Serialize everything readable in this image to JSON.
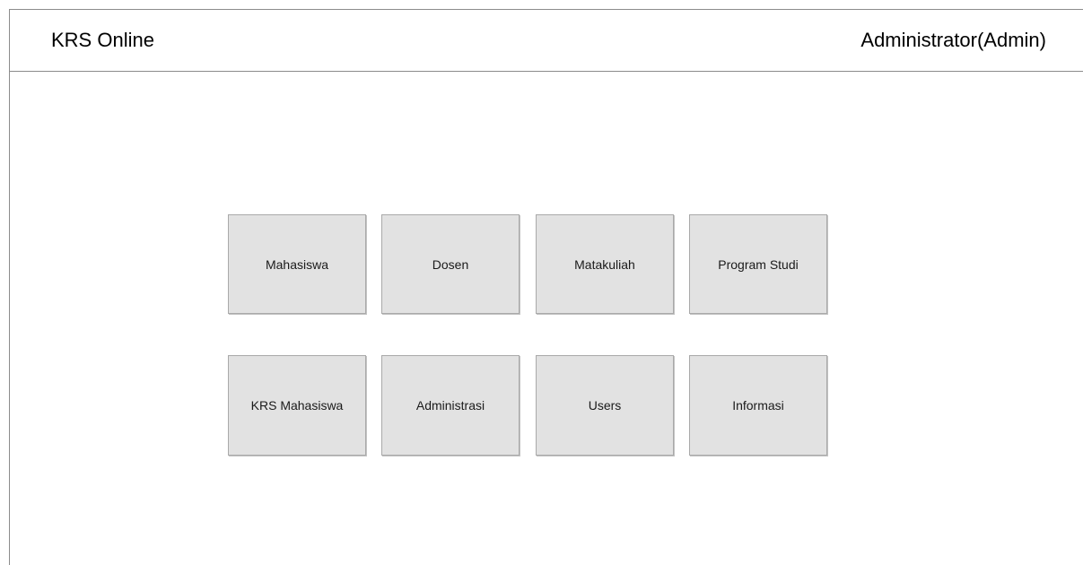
{
  "header": {
    "app_title": "KRS Online",
    "user_label": "Administrator(Admin)"
  },
  "menu": {
    "items": [
      {
        "label": "Mahasiswa"
      },
      {
        "label": "Dosen"
      },
      {
        "label": "Matakuliah"
      },
      {
        "label": "Program Studi"
      },
      {
        "label": "KRS Mahasiswa"
      },
      {
        "label": "Administrasi"
      },
      {
        "label": "Users"
      },
      {
        "label": "Informasi"
      }
    ]
  },
  "colors": {
    "tile_background": "#e2e2e2",
    "tile_border": "#a9a9a9",
    "divider": "#8c8c8c"
  }
}
